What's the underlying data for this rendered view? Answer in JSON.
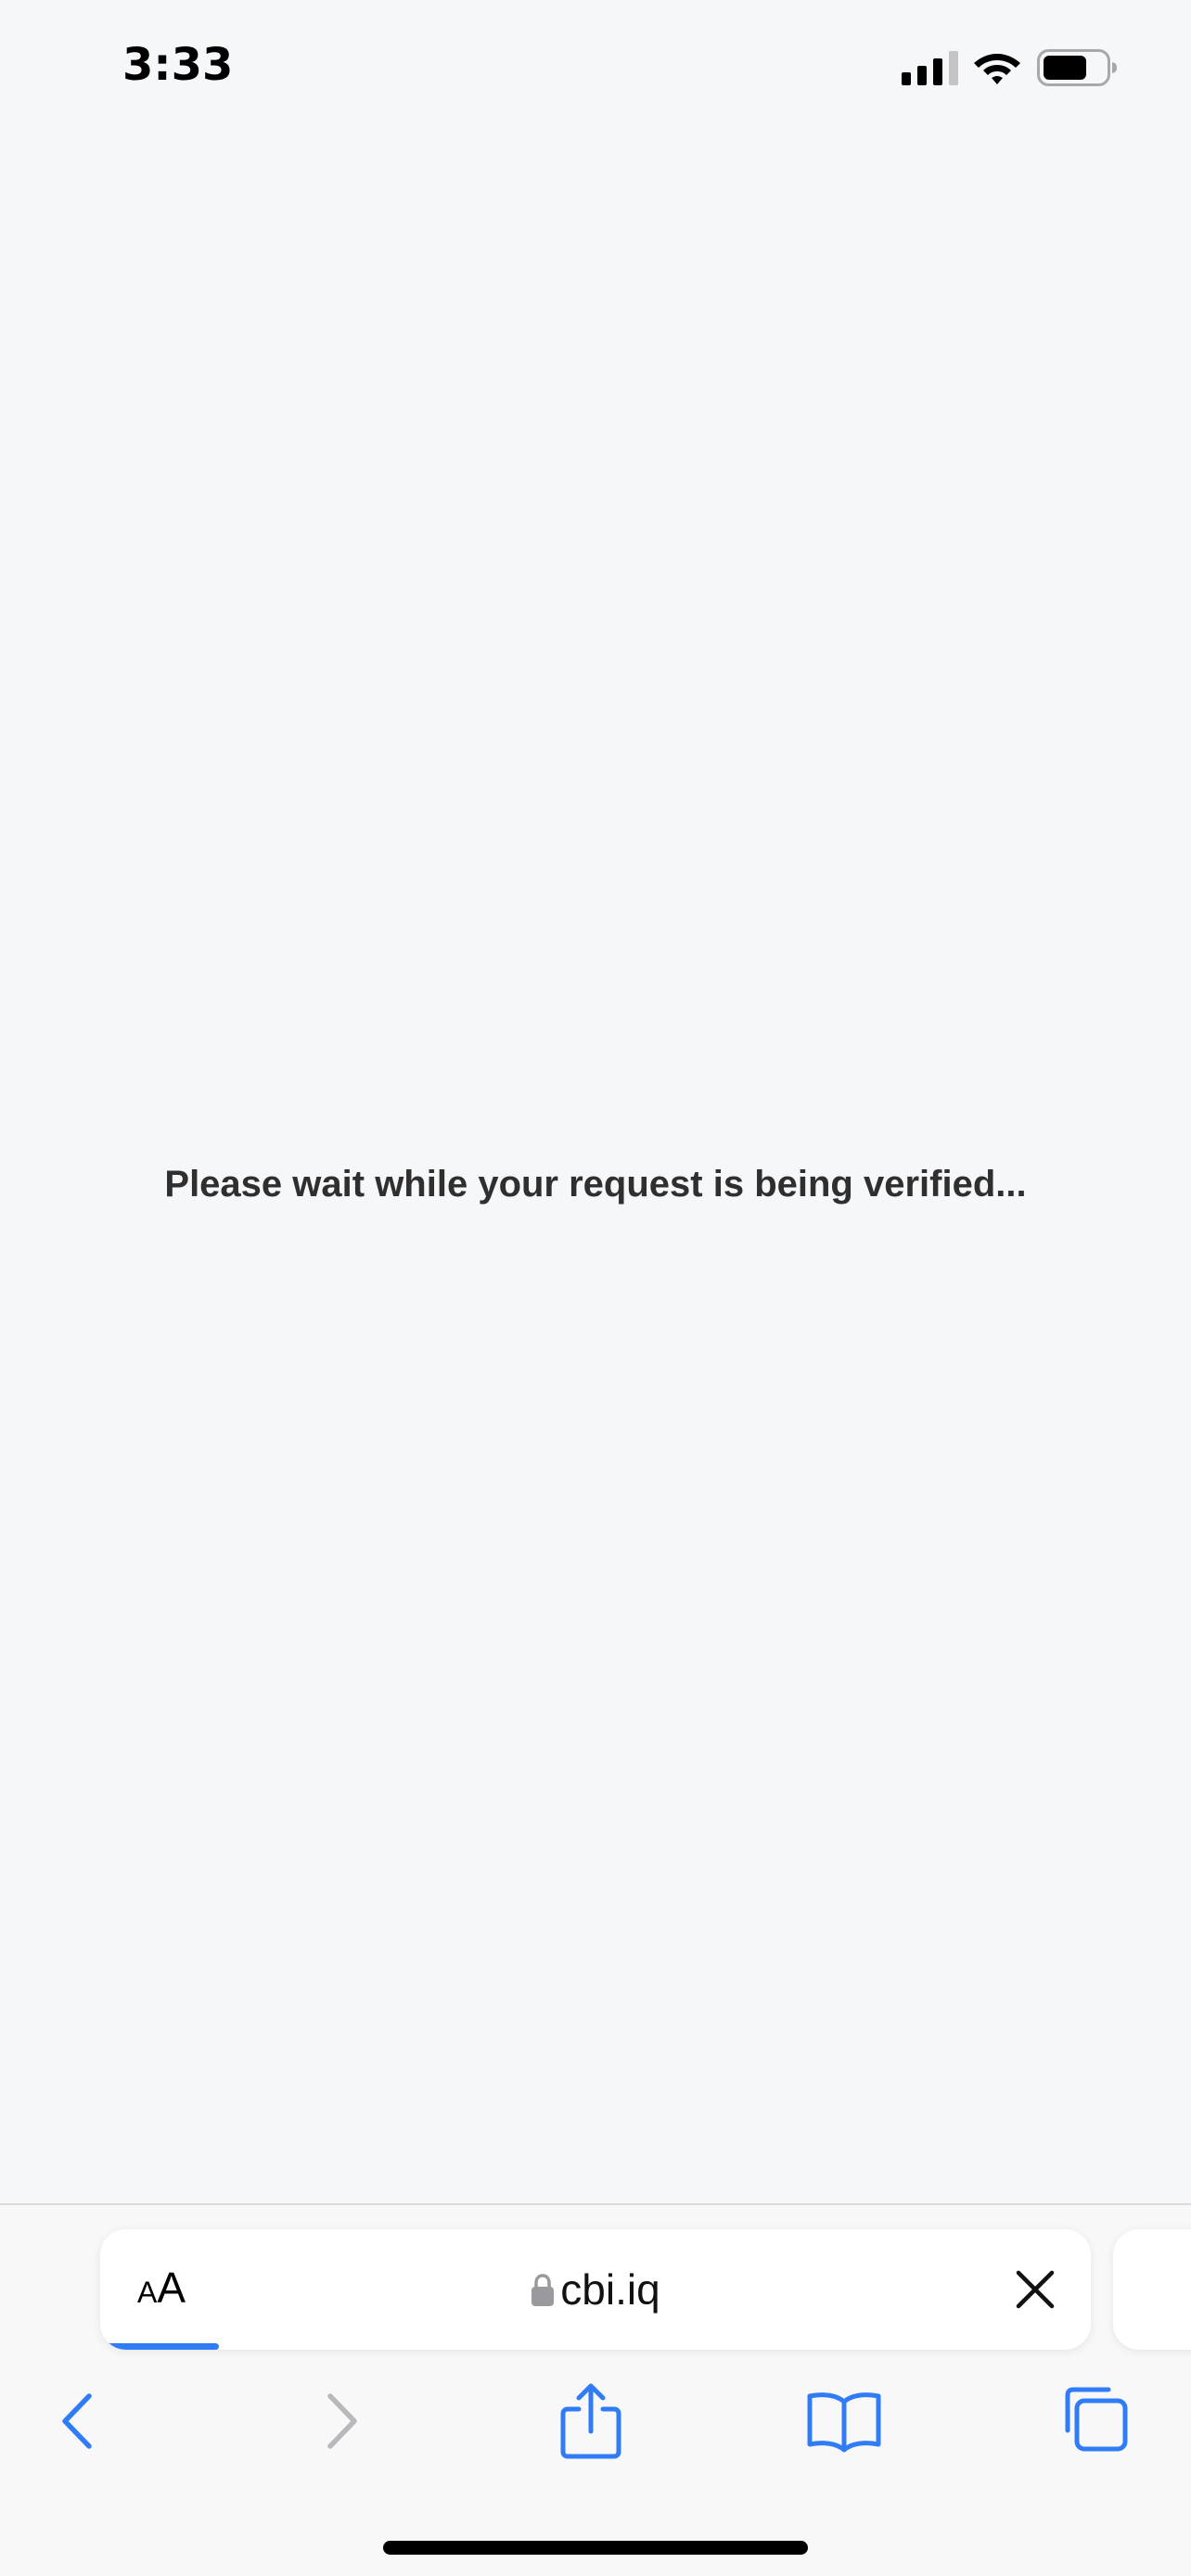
{
  "status_bar": {
    "time": "3:33",
    "icons": [
      "signal-icon",
      "wifi-icon",
      "battery-icon"
    ]
  },
  "page": {
    "message": "Please wait while your request is being verified..."
  },
  "address_bar": {
    "reader_small": "A",
    "reader_large": "A",
    "url": "cbi.iq",
    "load_progress_percent": 12,
    "icons": [
      "lock-icon",
      "close-icon"
    ]
  },
  "toolbar": {
    "buttons": [
      "back-icon",
      "forward-icon",
      "share-icon",
      "bookmarks-icon",
      "tabs-icon"
    ],
    "back_enabled": true,
    "forward_enabled": false
  },
  "colors": {
    "accent": "#2f7cf6",
    "page_background": "#f6f7f9",
    "message_text": "#2f2f2f",
    "disabled": "#b9b9bd"
  }
}
